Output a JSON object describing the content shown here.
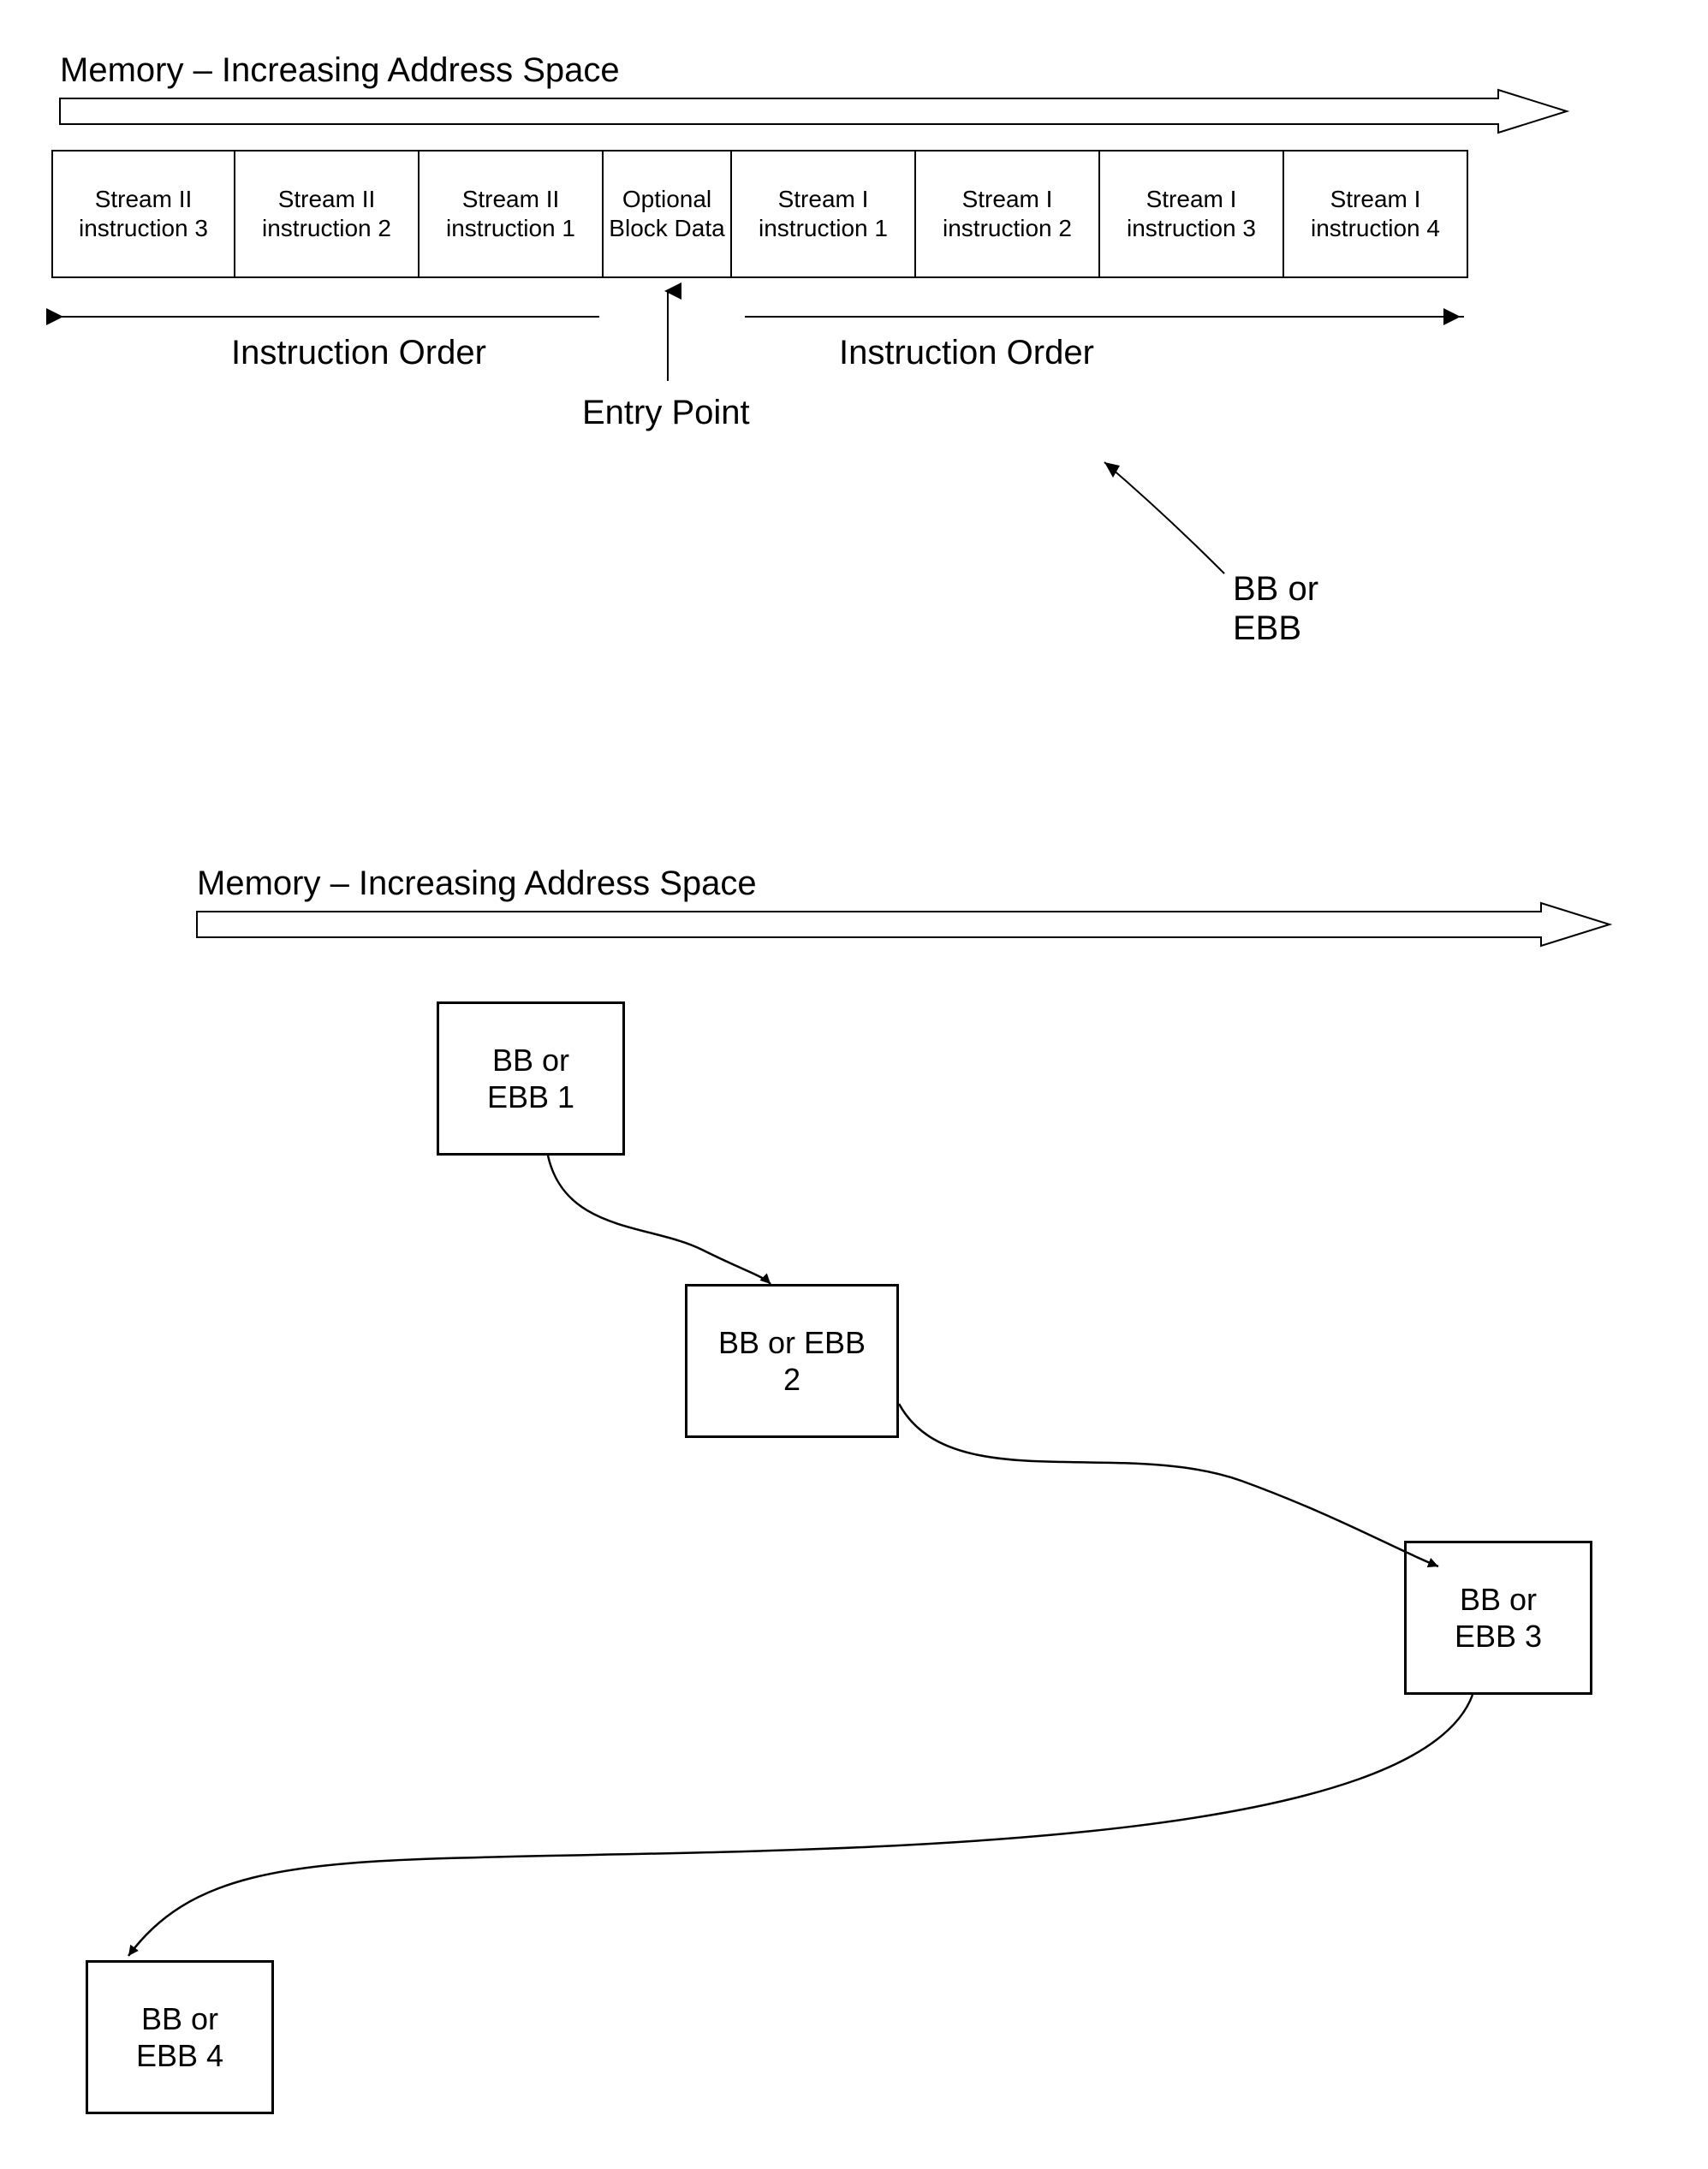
{
  "top": {
    "title": "Memory – Increasing Address Space",
    "cells": [
      "Stream II\ninstruction 3",
      "Stream II\ninstruction 2",
      "Stream II\ninstruction 1",
      "Optional\nBlock\nData",
      "Stream I\ninstruction 1",
      "Stream I\ninstruction 2",
      "Stream I\ninstruction 3",
      "Stream I\ninstruction 4"
    ],
    "instruction_order_left": "Instruction Order",
    "instruction_order_right": "Instruction Order",
    "entry_point": "Entry Point",
    "bb_label": "BB or\nEBB"
  },
  "bottom": {
    "title": "Memory – Increasing Address Space",
    "blocks": [
      "BB or\nEBB 1",
      "BB or EBB\n2",
      "BB or\nEBB 3",
      "BB or\nEBB 4"
    ]
  }
}
